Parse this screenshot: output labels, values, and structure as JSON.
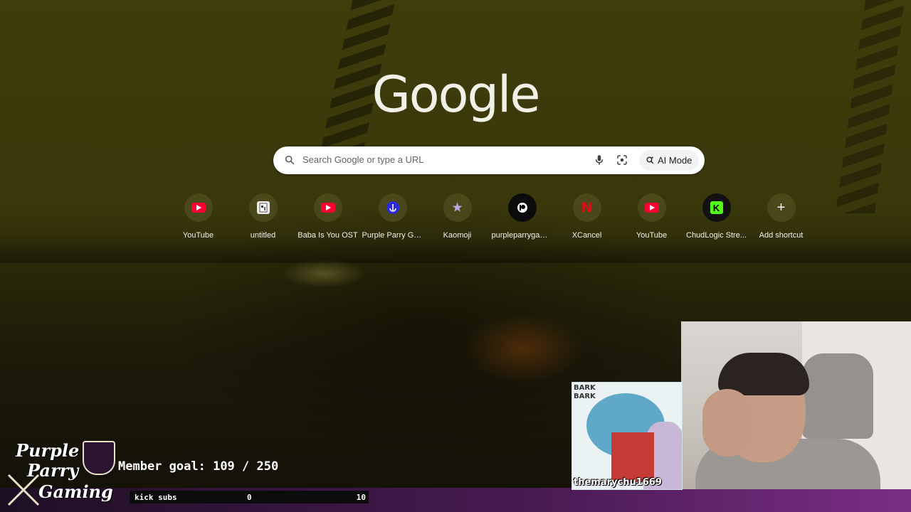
{
  "logo_text": "Google",
  "search": {
    "placeholder": "Search Google or type a URL",
    "ai_mode_label": "AI Mode"
  },
  "shortcuts": [
    {
      "label": "YouTube",
      "icon": "youtube-icon"
    },
    {
      "label": "untitled",
      "icon": "document-icon"
    },
    {
      "label": "Baba Is You OST",
      "icon": "youtube-icon"
    },
    {
      "label": "Purple Parry Ga...",
      "icon": "purple-parry-icon"
    },
    {
      "label": "Kaomoji",
      "icon": "kaomoji-icon"
    },
    {
      "label": "purpleparrygam...",
      "icon": "patreon-icon"
    },
    {
      "label": "XCancel",
      "icon": "netflix-n-icon"
    },
    {
      "label": "YouTube",
      "icon": "youtube-icon"
    },
    {
      "label": "ChudLogic Stre...",
      "icon": "kick-icon"
    },
    {
      "label": "Add shortcut",
      "icon": "plus-icon"
    }
  ],
  "overlay": {
    "channel_logo_lines": [
      "Purple",
      "Parry",
      "Gaming"
    ],
    "member_goal_label": "Member goal:",
    "member_goal_current": "109",
    "member_goal_target": "250",
    "member_goal_separator": "/",
    "kick_subs_label": "kick subs",
    "kick_subs_current": "0",
    "kick_subs_target": "10",
    "art_handle": "themarychu1669",
    "art_caption": "BARK\nBARK"
  }
}
